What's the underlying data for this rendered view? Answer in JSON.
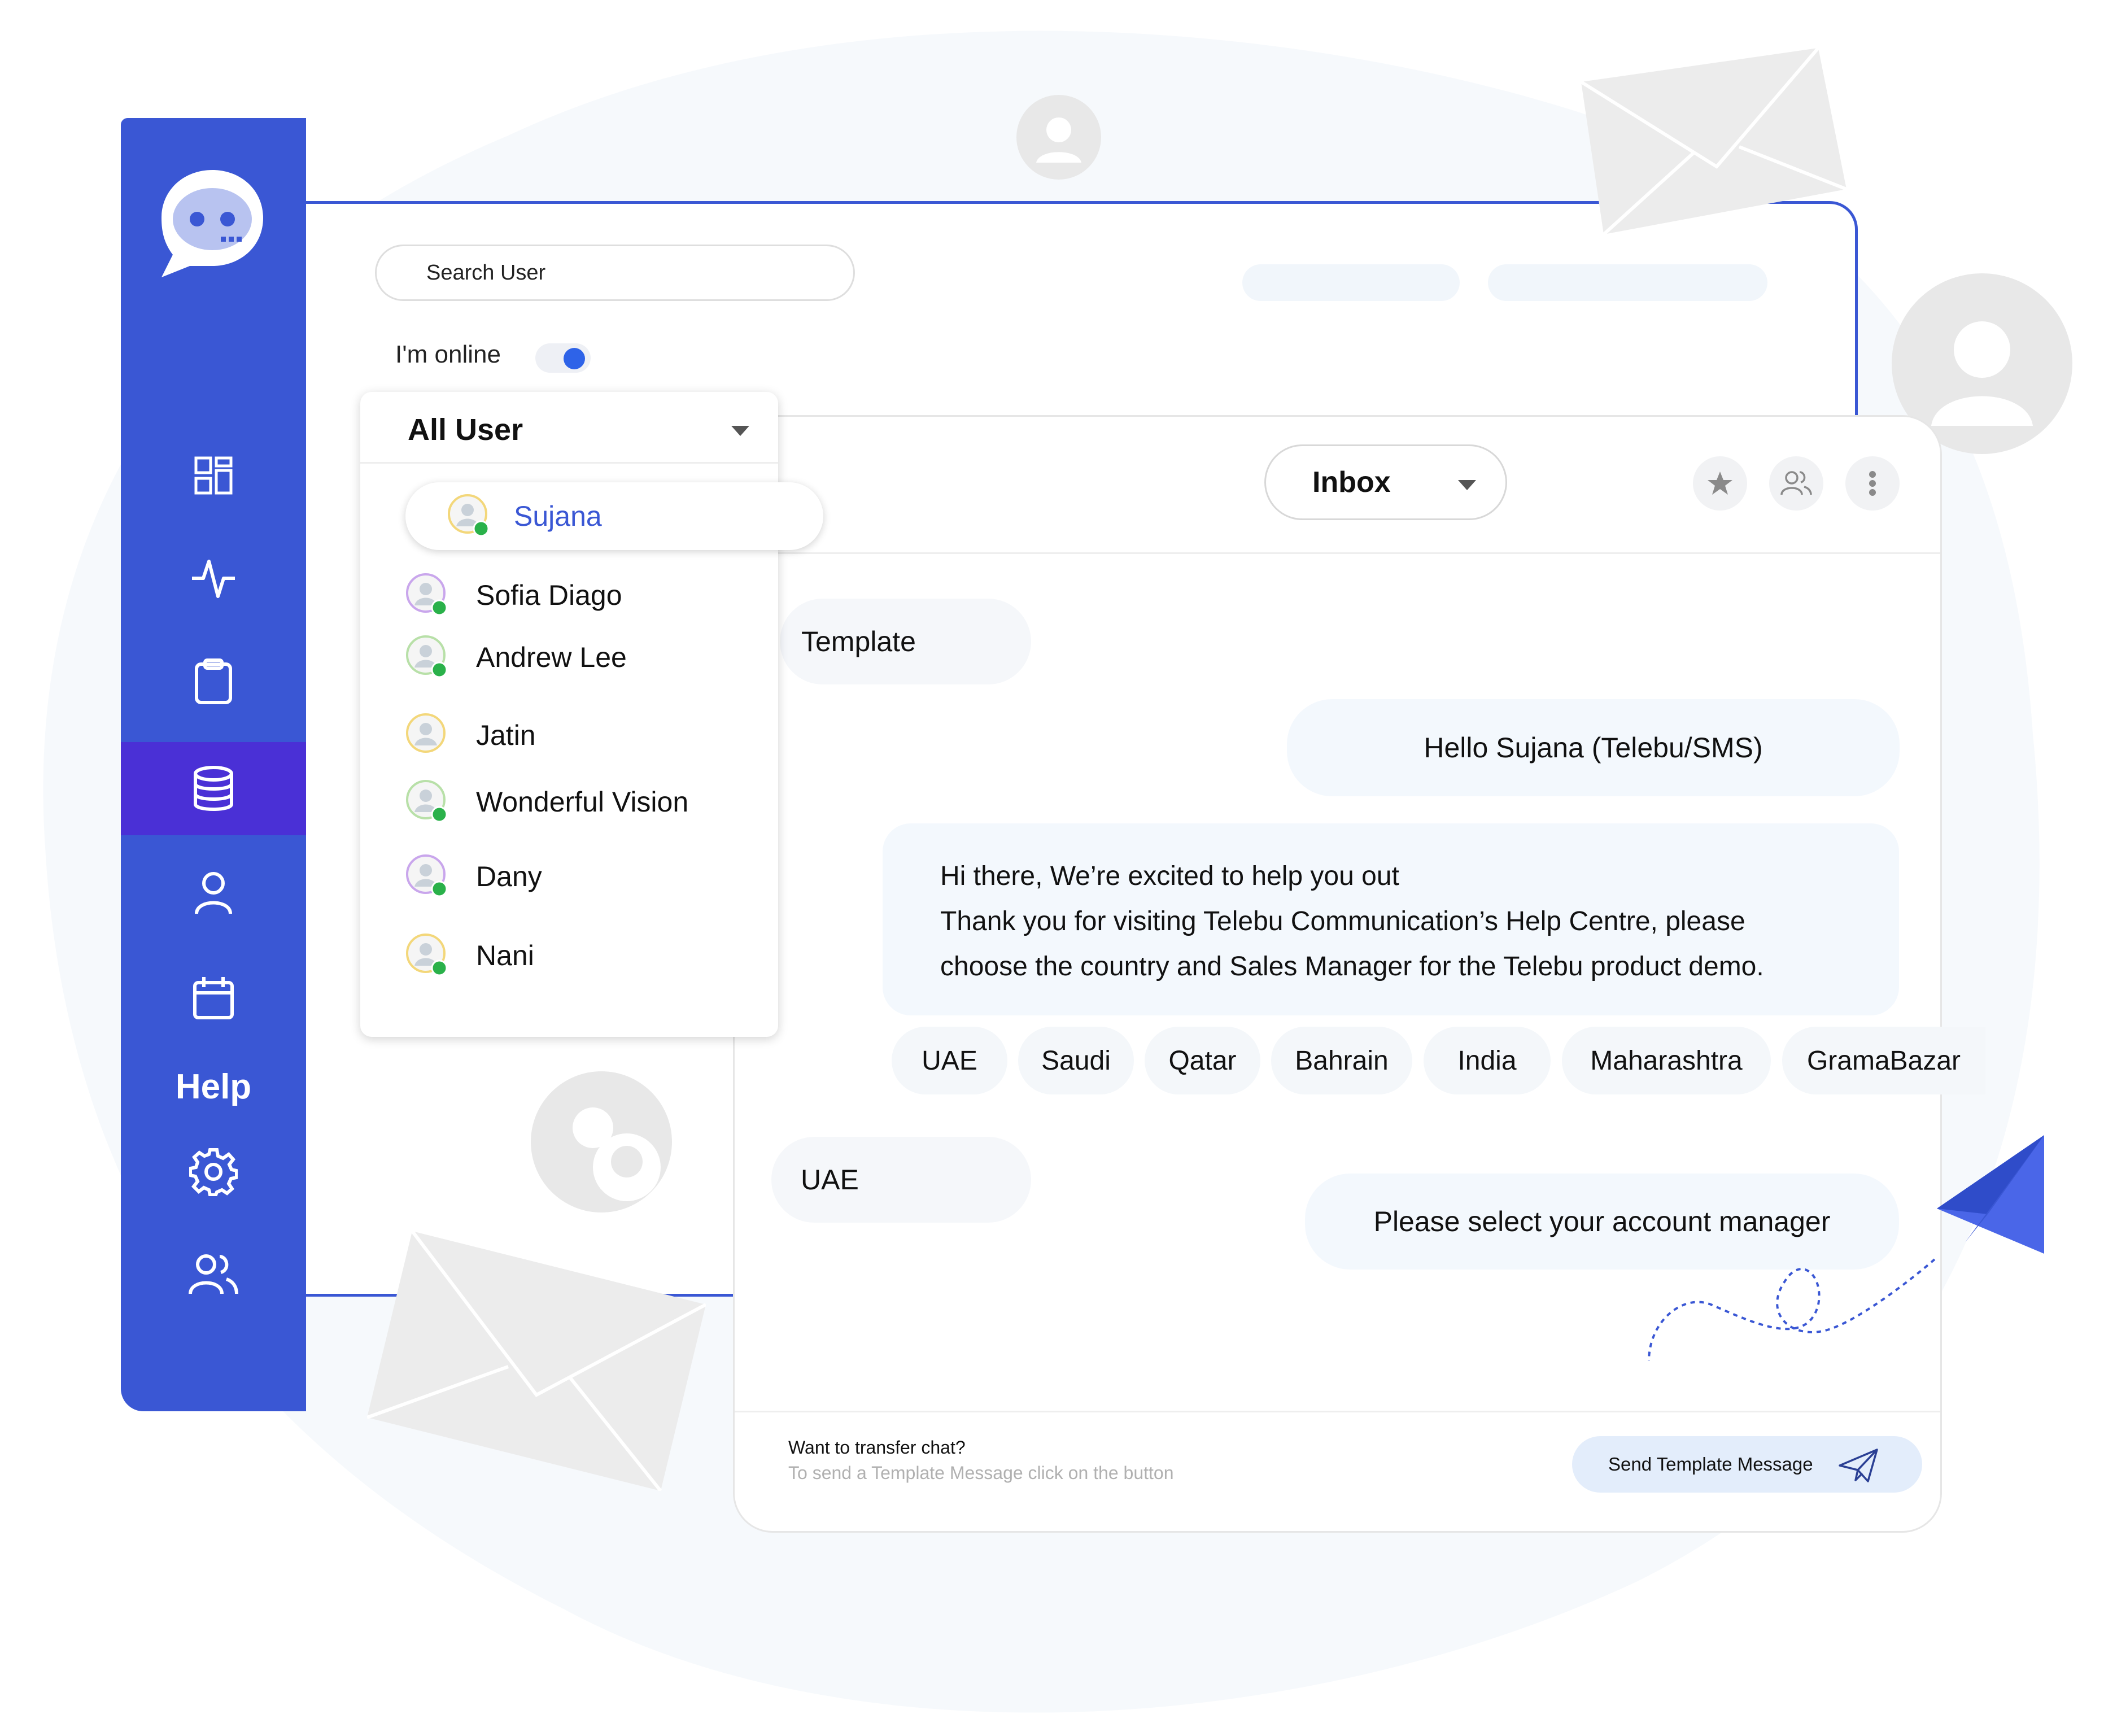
{
  "colors": {
    "brand": "#3a57d4",
    "sidebar_active": "#4a30d6",
    "toggle_on": "#2e63e8",
    "bubble_bg": "#f3f8fd",
    "online_dot": "#2ab14a"
  },
  "sidebar": {
    "logo_icon": "chat-bubble-logo-icon",
    "items": [
      {
        "icon": "dashboard-grid-icon"
      },
      {
        "icon": "activity-pulse-icon"
      },
      {
        "icon": "clipboard-icon"
      },
      {
        "icon": "database-icon",
        "active": true
      },
      {
        "icon": "user-icon"
      },
      {
        "icon": "calendar-icon"
      }
    ],
    "help_label": "Help",
    "bottom_items": [
      {
        "icon": "gear-icon"
      },
      {
        "icon": "users-group-icon"
      }
    ]
  },
  "search": {
    "placeholder": "Search User"
  },
  "status": {
    "online_label": "I'm online",
    "online": true
  },
  "user_list": {
    "filter_label": "All User",
    "users": [
      {
        "name": "Sujana",
        "selected": true
      },
      {
        "name": "Sofia Diago"
      },
      {
        "name": "Andrew Lee"
      },
      {
        "name": "Jatin"
      },
      {
        "name": "Wonderful Vision"
      },
      {
        "name": "Dany"
      },
      {
        "name": "Nani"
      }
    ]
  },
  "chat": {
    "folder_label": "Inbox",
    "header_icons": [
      "star-icon",
      "users-icon",
      "more-vertical-icon"
    ],
    "messages": {
      "template_label": "Template",
      "greeting": "Hello Sujana (Telebu/SMS)",
      "body_lines": [
        "Hi there, We’re excited to help you out",
        "Thank you for visiting Telebu Communication’s Help Centre, please",
        "choose the country and Sales Manager for the Telebu product demo."
      ],
      "options": [
        "UAE",
        "Saudi",
        "Qatar",
        "Bahrain",
        "India",
        "Maharashtra",
        "GramaBazar"
      ],
      "user_reply": "UAE",
      "prompt": "Please select your account manager"
    },
    "footer": {
      "title": "Want to transfer chat?",
      "subtitle": "To send a Template Message click on the button",
      "send_label": "Send Template Message"
    }
  }
}
